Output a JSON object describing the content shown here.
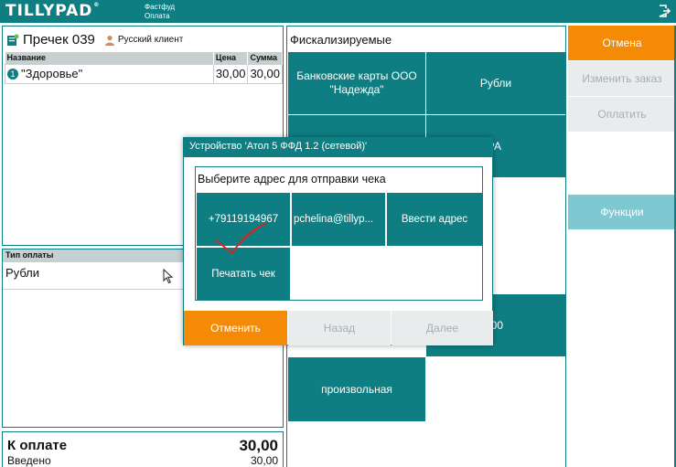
{
  "app": {
    "logo": "TILLYPAD",
    "section": "Фастфуд",
    "subsection": "Оплата"
  },
  "order": {
    "title": "Пречек 039",
    "guest": "Русский клиент",
    "columns": [
      "Название",
      "Цена",
      "Сумма"
    ],
    "items": [
      {
        "num": "1",
        "name": "\"Здоровье\"",
        "price": "30,00",
        "sum": "30,00"
      }
    ]
  },
  "payment": {
    "header": "Тип оплаты",
    "method": "Рубли"
  },
  "totals": {
    "due_label": "К оплате",
    "due_value": "30,00",
    "entered_label": "Введено",
    "entered_value": "30,00"
  },
  "fiscal": {
    "title": "Фискализируемые",
    "tiles": [
      {
        "label": "Банковские карты ООО \"Надежда\""
      },
      {
        "label": "Рубли"
      },
      {
        "label": "РА"
      },
      {
        "label": "00"
      },
      {
        "label": "произвольная"
      }
    ]
  },
  "right_panel": {
    "cancel": "Отмена",
    "change_order": "Изменить заказ",
    "pay": "Оплатить",
    "functions": "Функции"
  },
  "modal": {
    "title": "Устройство 'Атол 5 ФФД 1.2 (сетевой)'",
    "prompt": "Выберите адрес для отправки чека",
    "options": [
      {
        "label": "+79119194967"
      },
      {
        "label": "pchelina@tillyp..."
      },
      {
        "label": "Ввести адрес"
      },
      {
        "label": "Печатать чек"
      }
    ],
    "buttons": {
      "cancel": "Отменить",
      "back": "Назад",
      "next": "Далее"
    }
  },
  "colors": {
    "teal": "#0f7e82",
    "orange": "#f58a07",
    "disabled": "#e8ecec",
    "light_teal": "#7ec8d2",
    "annotation_red": "#e0201a"
  }
}
